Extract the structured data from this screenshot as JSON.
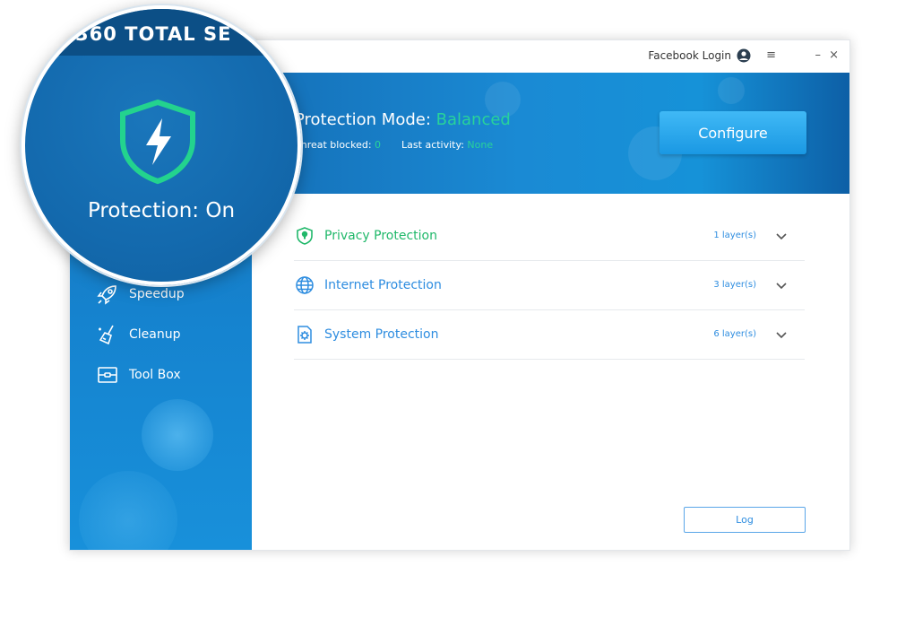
{
  "app": {
    "brand_partial": "360 TOTAL SE"
  },
  "titlebar": {
    "login_label": "Facebook Login",
    "menu_glyph": "≡",
    "minimize_glyph": "–",
    "close_glyph": "×"
  },
  "status": {
    "label": "Protection: On"
  },
  "sidebar": {
    "items": [
      {
        "label": "Speedup",
        "icon": "rocket-icon"
      },
      {
        "label": "Cleanup",
        "icon": "broom-icon"
      },
      {
        "label": "Tool Box",
        "icon": "toolbox-icon"
      }
    ]
  },
  "banner": {
    "mode_label": "Protection Mode:",
    "mode_value": "Balanced",
    "threat_label": "Threat blocked:",
    "threat_value": "0",
    "activity_label": "Last activity:",
    "activity_value": "None",
    "configure_label": "Configure"
  },
  "protections": [
    {
      "label": "Privacy Protection",
      "layers": "1 layer(s)",
      "icon": "shield-lock-icon",
      "color": "#20b86a"
    },
    {
      "label": "Internet Protection",
      "layers": "3 layer(s)",
      "icon": "globe-icon",
      "color": "#2e8de0"
    },
    {
      "label": "System Protection",
      "layers": "6 layer(s)",
      "icon": "gear-doc-icon",
      "color": "#2e8de0"
    }
  ],
  "log_label": "Log",
  "colors": {
    "accent_green": "#28d39a",
    "accent_blue": "#2e8de0",
    "sidebar": "#1583cf"
  }
}
